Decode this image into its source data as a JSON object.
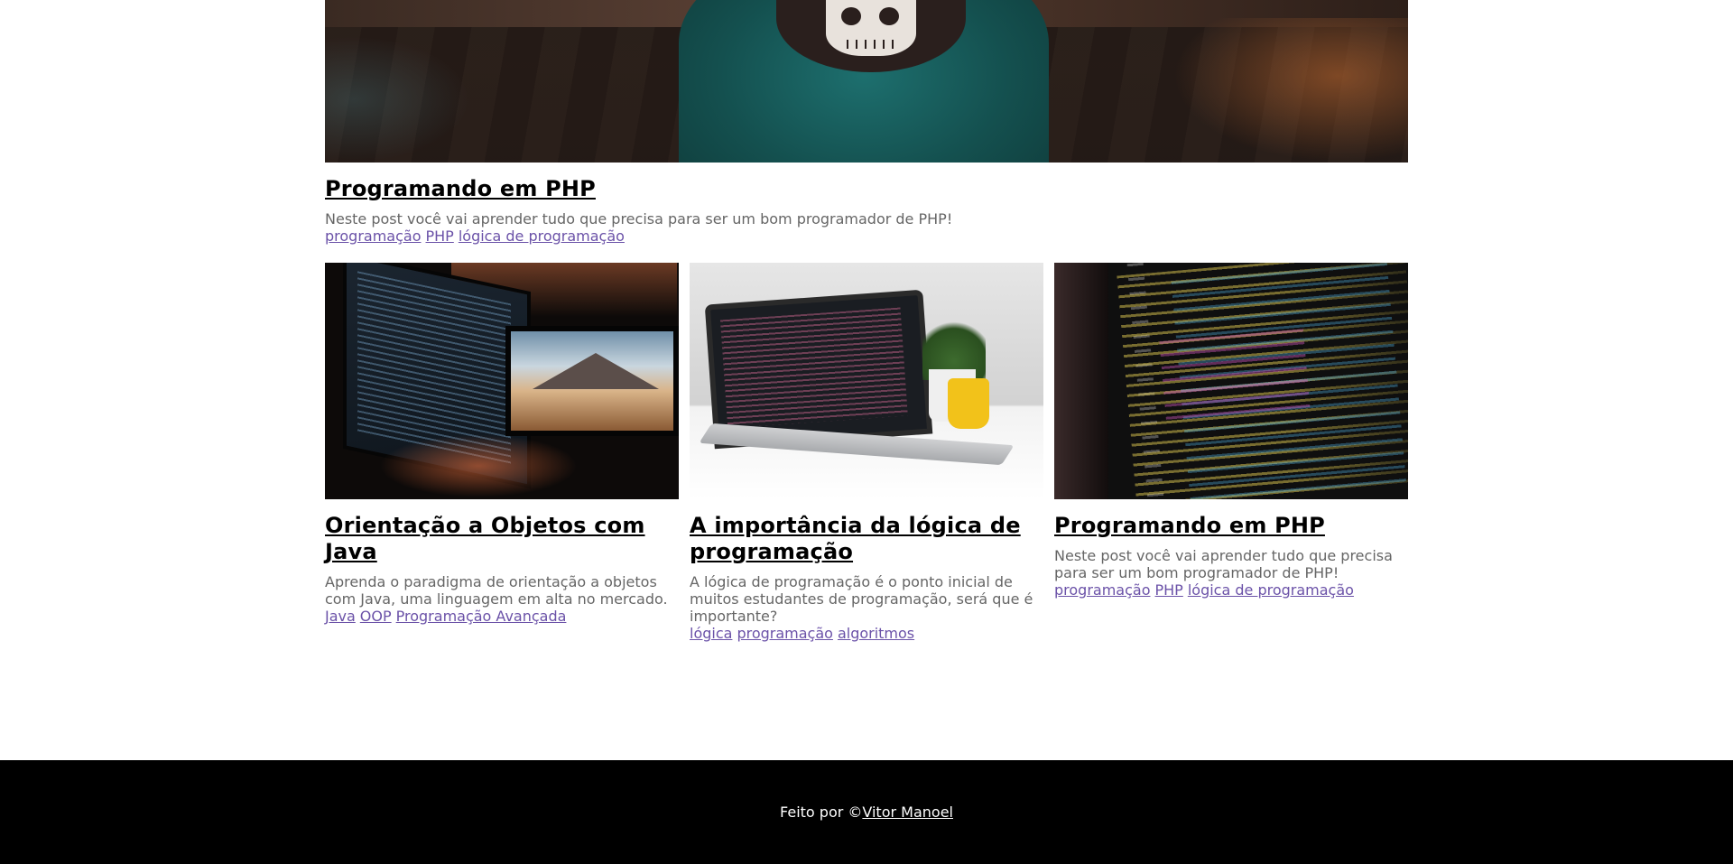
{
  "featured_post": {
    "title": "Programando em PHP",
    "description": "Neste post você vai aprender tudo que precisa para ser um bom programador de PHP!",
    "tags": [
      "programação",
      "PHP",
      "lógica de programação"
    ]
  },
  "posts": [
    {
      "title": "Orientação a Objetos com Java",
      "description": "Aprenda o paradigma de orientação a objetos com Java, uma linguagem em alta no mercado.",
      "tags": [
        "Java",
        "OOP",
        "Programação Avançada"
      ]
    },
    {
      "title": "A importância da lógica de programação",
      "description": "A lógica de programação é o ponto inicial de muitos estudantes de programação, será que é importante?",
      "tags": [
        "lógica",
        "programação",
        "algoritmos"
      ]
    },
    {
      "title": "Programando em PHP",
      "description": "Neste post você vai aprender tudo que precisa para ser um bom programador de PHP!",
      "tags": [
        "programação",
        "PHP",
        "lógica de programação"
      ]
    }
  ],
  "footer": {
    "prefix": "Feito por ©",
    "author": "Vitor Manoel"
  },
  "colors": {
    "title": "#000000",
    "description": "#666666",
    "tag_link": "#6b52a8",
    "footer_bg": "#000000",
    "footer_text": "#ffffff"
  }
}
